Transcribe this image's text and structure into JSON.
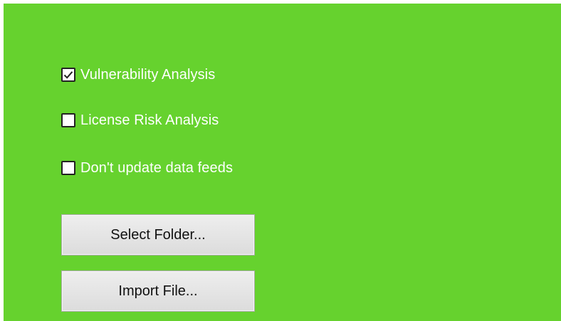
{
  "options": {
    "vulnerability_analysis": {
      "label": "Vulnerability Analysis",
      "checked": true
    },
    "license_risk_analysis": {
      "label": "License Risk Analysis",
      "checked": false
    },
    "dont_update_data_feeds": {
      "label": "Don't update data feeds",
      "checked": false
    }
  },
  "buttons": {
    "select_folder": "Select Folder...",
    "import_file": "Import File..."
  },
  "colors": {
    "panel_background": "#66d22e",
    "label_text": "#ffffff"
  },
  "icons": {
    "check": "checkmark-icon"
  }
}
